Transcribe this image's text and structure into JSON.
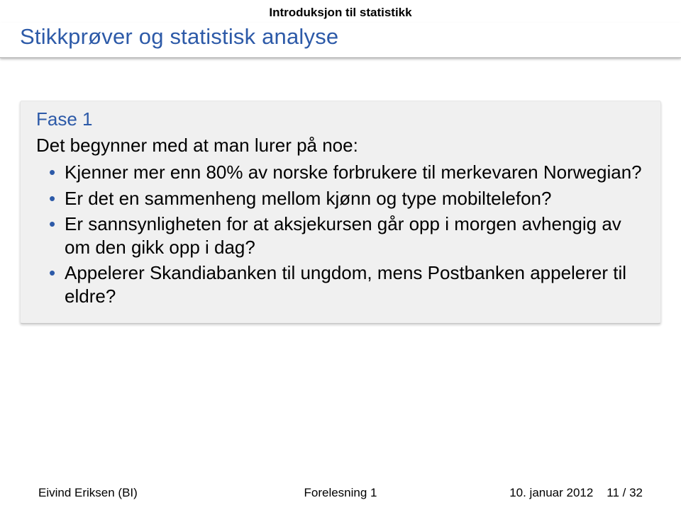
{
  "crumb": "Introduksjon til statistikk",
  "title": "Stikkprøver og statistisk analyse",
  "block": {
    "title": "Fase 1",
    "intro": "Det begynner med at man lurer på noe:",
    "items": [
      "Kjenner mer enn 80% av norske forbrukere til merkevaren Norwegian?",
      "Er det en sammenheng mellom kjønn og type mobiltelefon?",
      "Er sannsynligheten for at aksjekursen går opp i morgen avhengig av om den gikk opp i dag?",
      "Appelerer Skandiabanken til ungdom, mens Postbanken appelerer til eldre?"
    ]
  },
  "footer": {
    "author": "Eivind Eriksen (BI)",
    "center": "Forelesning 1",
    "date": "10. januar 2012",
    "page_current": "11",
    "page_sep": " / ",
    "page_total": "32"
  }
}
